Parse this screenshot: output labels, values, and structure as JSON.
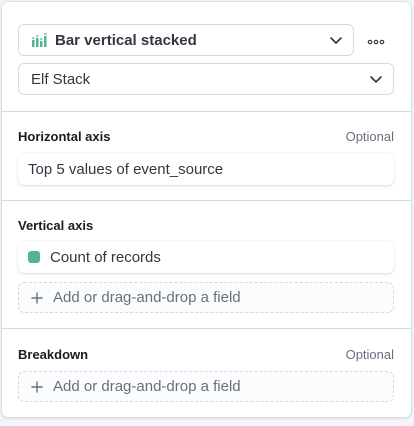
{
  "chart_type": {
    "label": "Bar vertical stacked",
    "icon": "bar-vertical-stacked-icon",
    "icon_color": "#54b399"
  },
  "more_actions": {
    "icon": "more-horizontal-icon"
  },
  "layer": {
    "label": "Elf Stack"
  },
  "sections": {
    "horizontal_axis": {
      "title": "Horizontal axis",
      "optional": "Optional",
      "field": "Top 5 values of event_source"
    },
    "vertical_axis": {
      "title": "Vertical axis",
      "field": "Count of records",
      "field_color": "#54b399",
      "add_label": "Add or drag-and-drop a field"
    },
    "breakdown": {
      "title": "Breakdown",
      "optional": "Optional",
      "add_label": "Add or drag-and-drop a field"
    }
  },
  "colors": {
    "border": "#d3dae6",
    "text": "#343741",
    "subdued": "#69707d",
    "accent": "#54b399"
  }
}
